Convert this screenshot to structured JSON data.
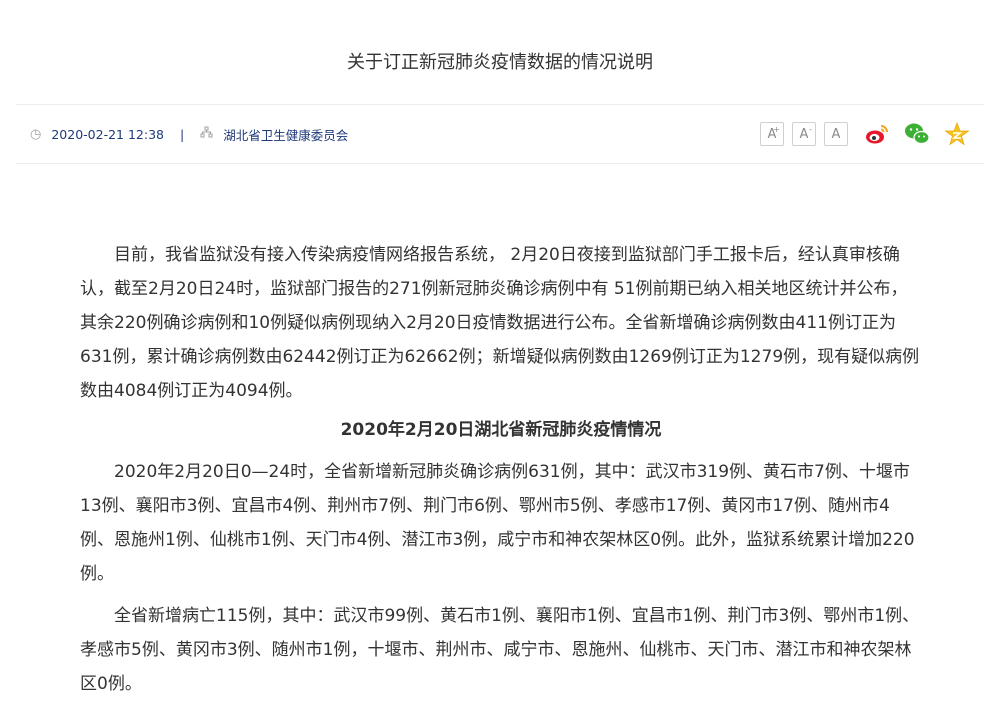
{
  "title": "关于订正新冠肺炎疫情数据的情况说明",
  "meta": {
    "datetime": "2020-02-21 12:38",
    "separator": "|",
    "source": "湖北省卫生健康委员会"
  },
  "font_controls": [
    "A",
    "A",
    "A"
  ],
  "share_icons": [
    "weibo-icon",
    "wechat-icon",
    "qzone-star-icon"
  ],
  "paragraphs": {
    "p1": "目前，我省监狱没有接入传染病疫情网络报告系统， 2月20日夜接到监狱部门手工报卡后，经认真审核确认，截至2月20日24时，监狱部门报告的271例新冠肺炎确诊病例中有 51例前期已纳入相关地区统计并公布，其余220例确诊病例和10例疑似病例现纳入2月20日疫情数据进行公布。全省新增确诊病例数由411例订正为631例，累计确诊病例数由62442例订正为62662例；新增疑似病例数由1269例订正为1279例，现有疑似病例数由4084例订正为4094例。",
    "heading": "2020年2月20日湖北省新冠肺炎疫情情况",
    "p2": "2020年2月20日0—24时，全省新增新冠肺炎确诊病例631例，其中：武汉市319例、黄石市7例、十堰市13例、襄阳市3例、宜昌市4例、荆州市7例、荆门市6例、鄂州市5例、孝感市17例、黄冈市17例、随州市4例、恩施州1例、仙桃市1例、天门市4例、潜江市3例，咸宁市和神农架林区0例。此外，监狱系统累计增加220例。",
    "p3": "全省新增病亡115例，其中：武汉市99例、黄石市1例、襄阳市1例、宜昌市1例、荆门市3例、鄂州市1例、孝感市5例、黄冈市3例、随州市1例，十堰市、荆州市、咸宁市、恩施州、仙桃市、天门市、潜江市和神农架林区0例。"
  }
}
